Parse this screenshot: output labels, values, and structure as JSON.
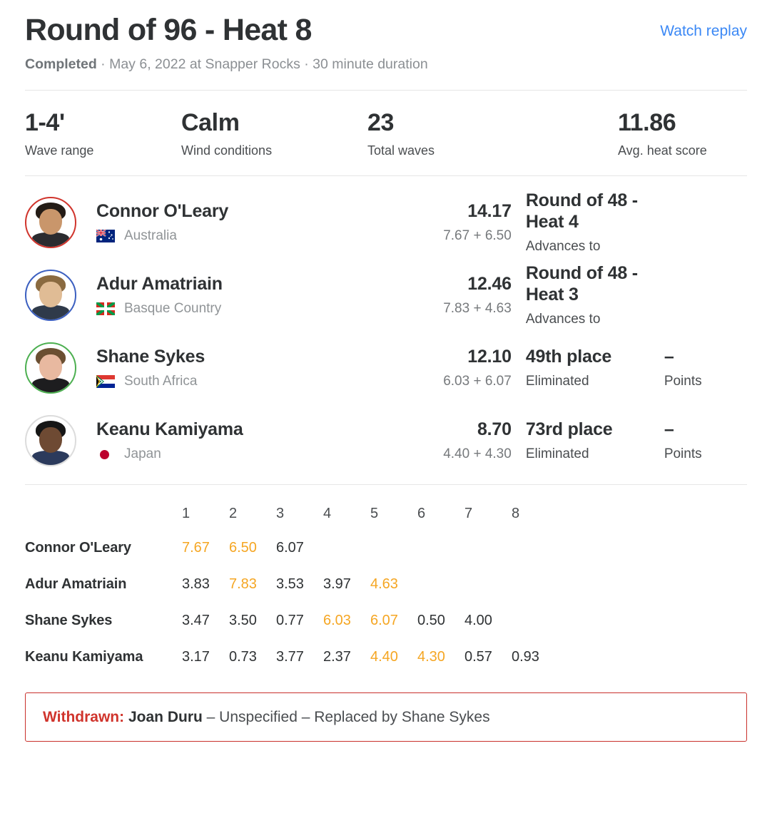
{
  "header": {
    "title": "Round of 96 - Heat 8",
    "watch_replay_label": "Watch replay",
    "status": "Completed",
    "meta": " · May 6, 2022 at Snapper Rocks · 30 minute duration",
    "link_color": "#3b88f5"
  },
  "stats": [
    {
      "value": "1-4'",
      "label": "Wave range"
    },
    {
      "value": "Calm",
      "label": "Wind conditions"
    },
    {
      "value": "23",
      "label": "Total waves"
    },
    {
      "value": "11.86",
      "label": "Avg. heat score"
    }
  ],
  "athletes": [
    {
      "name": "Connor O'Leary",
      "country": "Australia",
      "flag": "au-flag-icon",
      "ring_color": "#d0342c",
      "total": "14.17",
      "breakdown": "7.67 + 6.50",
      "placement": "Round of 48 - Heat 4",
      "placement_sub": "Advances to",
      "points_value": "",
      "points_label": "",
      "has_points": false
    },
    {
      "name": "Adur Amatriain",
      "country": "Basque Country",
      "flag": "basque-flag-icon",
      "ring_color": "#3b5fc0",
      "total": "12.46",
      "breakdown": "7.83 + 4.63",
      "placement": "Round of 48 - Heat 3",
      "placement_sub": "Advances to",
      "points_value": "",
      "points_label": "",
      "has_points": false
    },
    {
      "name": "Shane Sykes",
      "country": "South Africa",
      "flag": "za-flag-icon",
      "ring_color": "#4caf50",
      "total": "12.10",
      "breakdown": "6.03 + 6.07",
      "placement": "49th place",
      "placement_sub": "Eliminated",
      "points_value": "–",
      "points_label": "Points",
      "has_points": true
    },
    {
      "name": "Keanu Kamiyama",
      "country": "Japan",
      "flag": "jp-flag-icon",
      "ring_color": "#dcdcdc",
      "total": "8.70",
      "breakdown": "4.40 + 4.30",
      "placement": "73rd place",
      "placement_sub": "Eliminated",
      "points_value": "–",
      "points_label": "Points",
      "has_points": true
    }
  ],
  "wave_table": {
    "columns": [
      "1",
      "2",
      "3",
      "4",
      "5",
      "6",
      "7",
      "8"
    ],
    "counting_color": "#f5a623",
    "rows": [
      {
        "name": "Connor O'Leary",
        "scores": [
          "7.67",
          "6.50",
          "6.07",
          "",
          "",
          "",
          "",
          ""
        ],
        "counting": [
          true,
          true,
          false,
          false,
          false,
          false,
          false,
          false
        ]
      },
      {
        "name": "Adur Amatriain",
        "scores": [
          "3.83",
          "7.83",
          "3.53",
          "3.97",
          "4.63",
          "",
          "",
          ""
        ],
        "counting": [
          false,
          true,
          false,
          false,
          true,
          false,
          false,
          false
        ]
      },
      {
        "name": "Shane Sykes",
        "scores": [
          "3.47",
          "3.50",
          "0.77",
          "6.03",
          "6.07",
          "0.50",
          "4.00",
          ""
        ],
        "counting": [
          false,
          false,
          false,
          true,
          true,
          false,
          false,
          false
        ]
      },
      {
        "name": "Keanu Kamiyama",
        "scores": [
          "3.17",
          "0.73",
          "3.77",
          "2.37",
          "4.40",
          "4.30",
          "0.57",
          "0.93"
        ],
        "counting": [
          false,
          false,
          false,
          false,
          true,
          true,
          false,
          false
        ]
      }
    ]
  },
  "notice": {
    "label": "Withdrawn:",
    "name": "Joan Duru",
    "detail": " – Unspecified – Replaced by Shane Sykes",
    "border_color": "#c9302c",
    "label_color": "#d0342c"
  }
}
